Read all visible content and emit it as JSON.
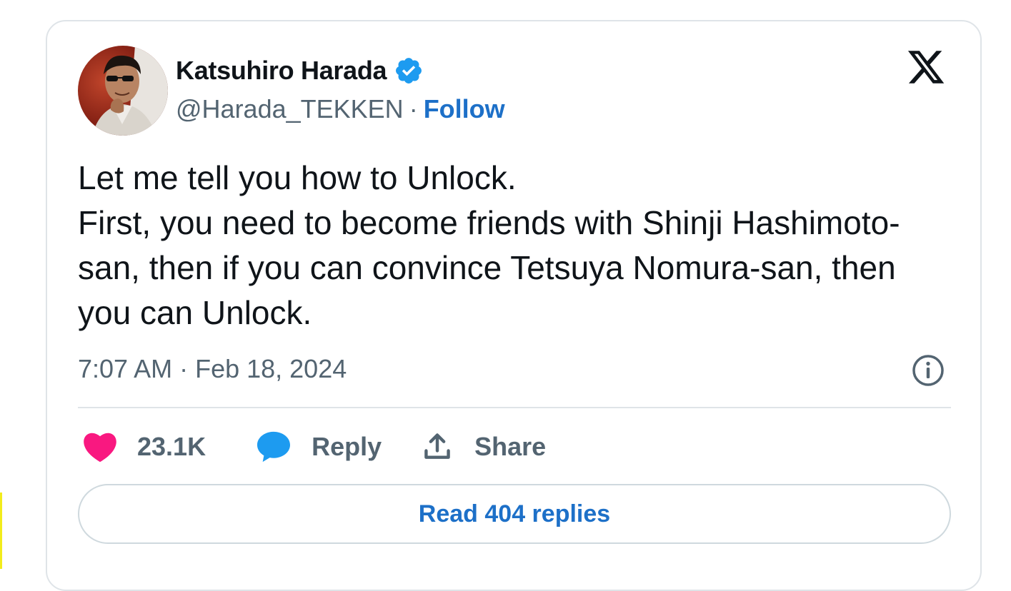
{
  "author": {
    "display_name": "Katsuhiro Harada",
    "handle": "@Harada_TEKKEN",
    "separator": "·",
    "follow_label": "Follow",
    "verified_icon": "verified-badge-icon",
    "avatar": "avatar-photo"
  },
  "platform_logo": "x-logo-icon",
  "tweet": {
    "text": "Let me tell you how to Unlock.\nFirst, you need to become friends with Shinji Hashimoto-san, then if you can convince Tetsuya Nomura-san, then you can Unlock.",
    "timestamp": "7:07 AM · Feb 18, 2024"
  },
  "actions": {
    "likes_count": "23.1K",
    "reply_label": "Reply",
    "share_label": "Share"
  },
  "read_replies_label": "Read 404 replies",
  "colors": {
    "accent": "#1d70c8",
    "like": "#f91880",
    "reply": "#1d9bf0",
    "verified": "#1d9bf0",
    "muted_text": "#536471",
    "border": "#dfe4e8"
  }
}
